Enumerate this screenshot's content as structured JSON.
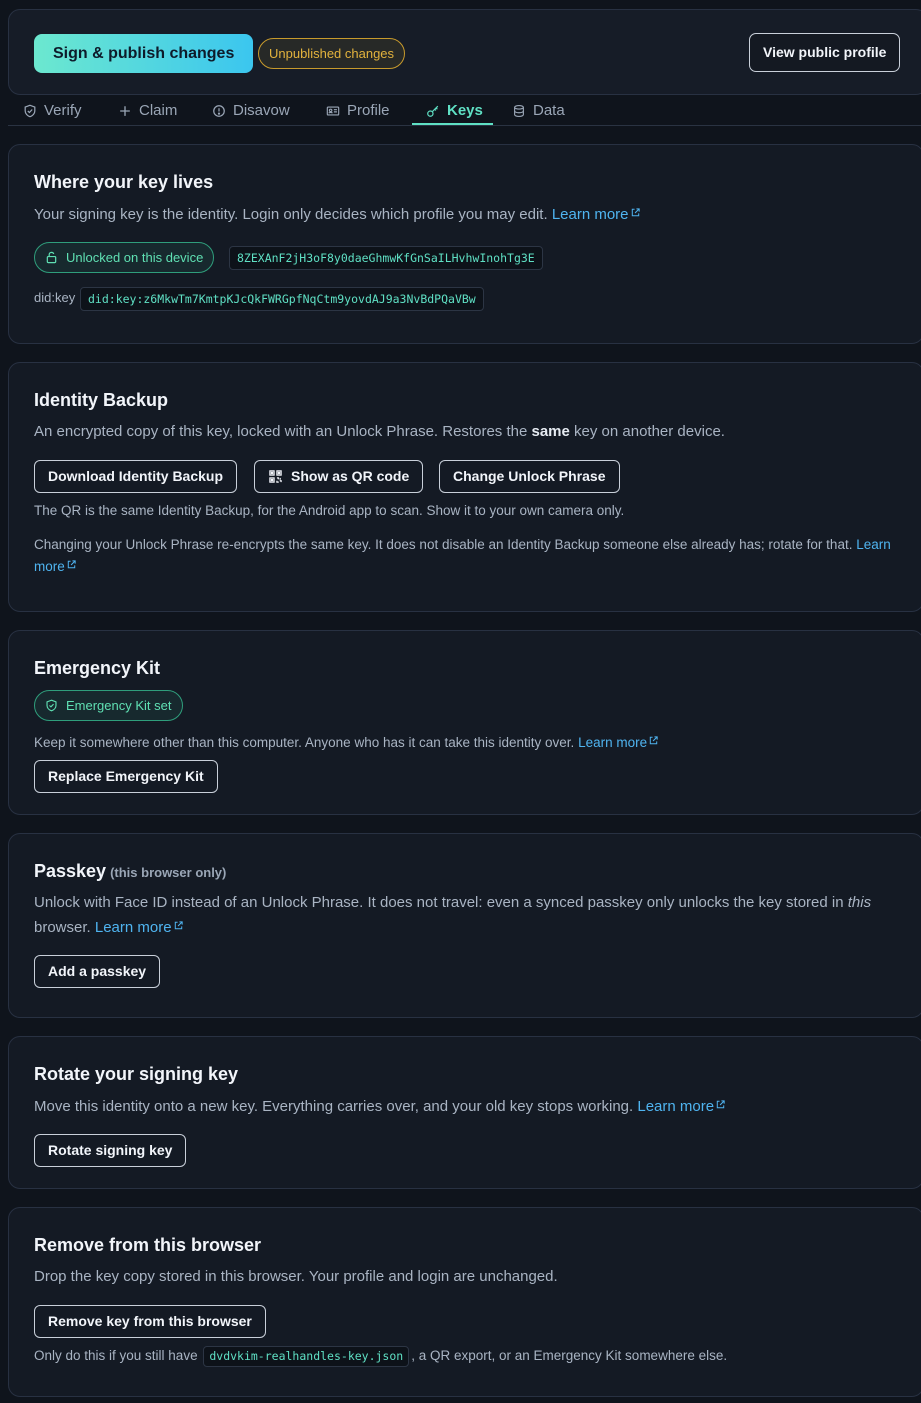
{
  "topbar": {
    "publish_label": "Sign & publish changes",
    "unpublished_label": "Unpublished changes",
    "view_profile_label": "View public profile"
  },
  "tabs": [
    {
      "label": "Verify",
      "icon": "shield-check-icon"
    },
    {
      "label": "Claim",
      "icon": "plus-icon"
    },
    {
      "label": "Disavow",
      "icon": "alert-circle-icon"
    },
    {
      "label": "Profile",
      "icon": "id-card-icon"
    },
    {
      "label": "Keys",
      "icon": "key-icon",
      "active": true
    },
    {
      "label": "Data",
      "icon": "database-icon"
    }
  ],
  "key_location": {
    "title": "Where your key lives",
    "desc": "Your signing key is the identity. Login only decides which profile you may edit.",
    "learn_more": "Learn more",
    "status_label": "Unlocked on this device",
    "key_fingerprint": "8ZEXAnF2jH3oF8y0daeGhmwKfGnSaILHvhwInohTg3E",
    "did_label": "did:key",
    "did_value": "did:key:z6MkwTm7KmtpKJcQkFWRGpfNqCtm9yovdAJ9a3NvBdPQaVBw"
  },
  "backup": {
    "title": "Identity Backup",
    "desc_before": "An encrypted copy of this key, locked with an Unlock Phrase. Restores the",
    "desc_bold": "same",
    "desc_after": "key on another device.",
    "download_label": "Download Identity Backup",
    "qr_label": "Show as QR code",
    "change_phrase_label": "Change Unlock Phrase",
    "qr_note": "The QR is the same Identity Backup, for the Android app to scan. Show it to your own camera only.",
    "rotate_note": "Changing your Unlock Phrase re-encrypts the same key. It does not disable an Identity Backup someone else already has; rotate for that.",
    "learn_more": "Learn more"
  },
  "emergency": {
    "title": "Emergency Kit",
    "status_label": "Emergency Kit set",
    "desc": "Keep it somewhere other than this computer. Anyone who has it can take this identity over.",
    "learn_more": "Learn more",
    "replace_label": "Replace Emergency Kit"
  },
  "passkey": {
    "title": "Passkey",
    "title_note": "(this browser only)",
    "desc_before": "Unlock with Face ID instead of an Unlock Phrase. It does not travel: even a synced passkey only unlocks the key stored in",
    "desc_italic": "this",
    "desc_after": "browser.",
    "learn_more": "Learn more",
    "add_label": "Add a passkey"
  },
  "rotate": {
    "title": "Rotate your signing key",
    "desc": "Move this identity onto a new key. Everything carries over, and your old key stops working.",
    "learn_more": "Learn more",
    "rotate_label": "Rotate signing key"
  },
  "remove": {
    "title": "Remove from this browser",
    "desc": "Drop the key copy stored in this browser. Your profile and login are unchanged.",
    "remove_label": "Remove key from this browser",
    "note_before": "Only do this if you still have",
    "note_file": "dvdvkim-realhandles-key.json",
    "note_after": ", a QR export, or an Emergency Kit somewhere else."
  },
  "colors": {
    "accent": "#5fe0c4",
    "link": "#4fb4f0",
    "warning": "#e2b23d",
    "background": "#0f141c",
    "card": "#141a24"
  }
}
